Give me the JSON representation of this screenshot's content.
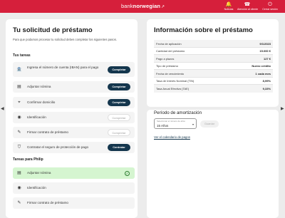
{
  "header": {
    "brand_light": "bank",
    "brand_bold": "norwegian",
    "brand_swoosh": "↗",
    "nav": [
      {
        "icon": "bell-icon",
        "glyph": "🔔",
        "label": "Noticias"
      },
      {
        "icon": "support-icon",
        "glyph": "☎",
        "label": "Atención al cliente"
      },
      {
        "icon": "logout-icon",
        "glyph": "⏻",
        "label": "Cerrar sesión"
      }
    ]
  },
  "left": {
    "title": "Tu solicitud de préstamo",
    "subtitle": "Para que podamos procesar tu solicitud debes completar los siguientes pasos.",
    "your_tasks_title": "Tus tareas",
    "tasks": [
      {
        "icon": "bank-icon",
        "glyph": "🏦",
        "label": "Ingresa el número de cuenta (IBAN) para el pago",
        "button": "Completar",
        "state": "active"
      },
      {
        "icon": "payslip-icon",
        "glyph": "▤",
        "label": "Adjuntar nómina",
        "button": "Completar",
        "state": "active"
      },
      {
        "icon": "location-icon",
        "glyph": "⌖",
        "label": "Confirmar domicilio",
        "button": "Completar",
        "state": "active"
      },
      {
        "icon": "id-icon",
        "glyph": "◉",
        "label": "Identificación",
        "button": "Completar",
        "state": "disabled"
      },
      {
        "icon": "sign-icon",
        "glyph": "✎",
        "label": "Firmar contrato de préstamo",
        "button": "Completar",
        "state": "disabled"
      },
      {
        "icon": "shield-icon",
        "glyph": "⛉",
        "label": "Contratar el seguro de protección de pago",
        "button": "Contratar",
        "state": "active"
      }
    ],
    "philip_title": "Tareas para Philip",
    "philip_tasks": [
      {
        "icon": "payslip-icon",
        "glyph": "▤",
        "label": "Adjuntar nómina",
        "state": "done"
      },
      {
        "icon": "id-icon",
        "glyph": "◉",
        "label": "Identificación",
        "state": "pending"
      },
      {
        "icon": "sign-icon",
        "glyph": "✎",
        "label": "Firmar contrato de préstamo",
        "state": "pending"
      }
    ]
  },
  "right": {
    "title": "Información sobre el préstamo",
    "info": [
      {
        "key": "Fecha de aplicación",
        "value": "9/1/2023"
      },
      {
        "key": "Cantidad del préstamo",
        "value": "15.000 €"
      },
      {
        "key": "Pago a plazos",
        "value": "127 €"
      },
      {
        "key": "Tipo de préstamo",
        "value": "Nuevo crédito"
      },
      {
        "key": "Fecha de vencimiento",
        "value": "1 cada mes"
      },
      {
        "key": "Tasa de Interés Nominal (TIN)",
        "value": "8,99%"
      },
      {
        "key": "Tasa Anual Efectiva (TAE)",
        "value": "9,33%"
      }
    ],
    "amortization_title": "Período de amortización",
    "select_label": "Seleccionar el número de años",
    "select_value": "15 Años",
    "update_button": "Guardar",
    "schedule_link": "Ver el calendario de pagos"
  },
  "colors": {
    "brand": "#d61f3b",
    "button": "#14364d",
    "done": "#d5f5d0"
  }
}
